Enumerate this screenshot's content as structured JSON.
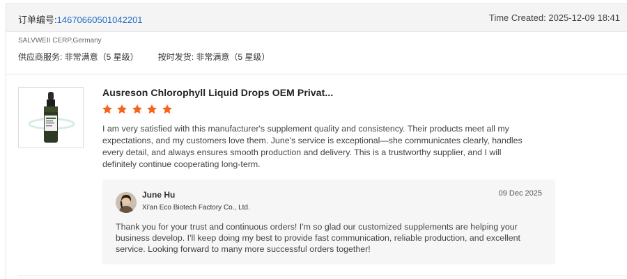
{
  "order": {
    "number_label": "订单编号:",
    "number": "14670660501042201",
    "time_created": "Time Created: 2025-12-09 18:41"
  },
  "supplier": {
    "name": "SALVWEII CERP,Germany",
    "ratings": [
      "供应商服务: 非常满意（5 星级）",
      "按时发货: 非常满意（5 星级）"
    ]
  },
  "review": {
    "product_title": "Ausreson Chlorophyll Liquid Drops OEM Privat...",
    "rating_stars": 5,
    "star_color": "#f5631c",
    "text": "I am very satisfied with this manufacturer's supplement quality and consistency. Their products meet all my expectations, and my customers love them. June's service is exceptional—she communicates clearly, handles every detail, and always ensures smooth production and delivery. This is a trustworthy supplier, and I will definitely continue cooperating long-term."
  },
  "reply": {
    "author": "June Hu",
    "company": "Xi'an Eco Biotech Factory Co., Ltd.",
    "date": "09 Dec 2025",
    "text": "Thank you for your trust and continuous orders! I'm so glad our customized supplements are helping your business develop. I'll keep doing my best to provide fast communication, reliable production, and excellent service. Looking forward to many more successful orders together!"
  },
  "colors": {
    "link": "#1f6bc4",
    "header_bg": "#f4f4f4",
    "reply_bg": "#f6f6f7"
  }
}
